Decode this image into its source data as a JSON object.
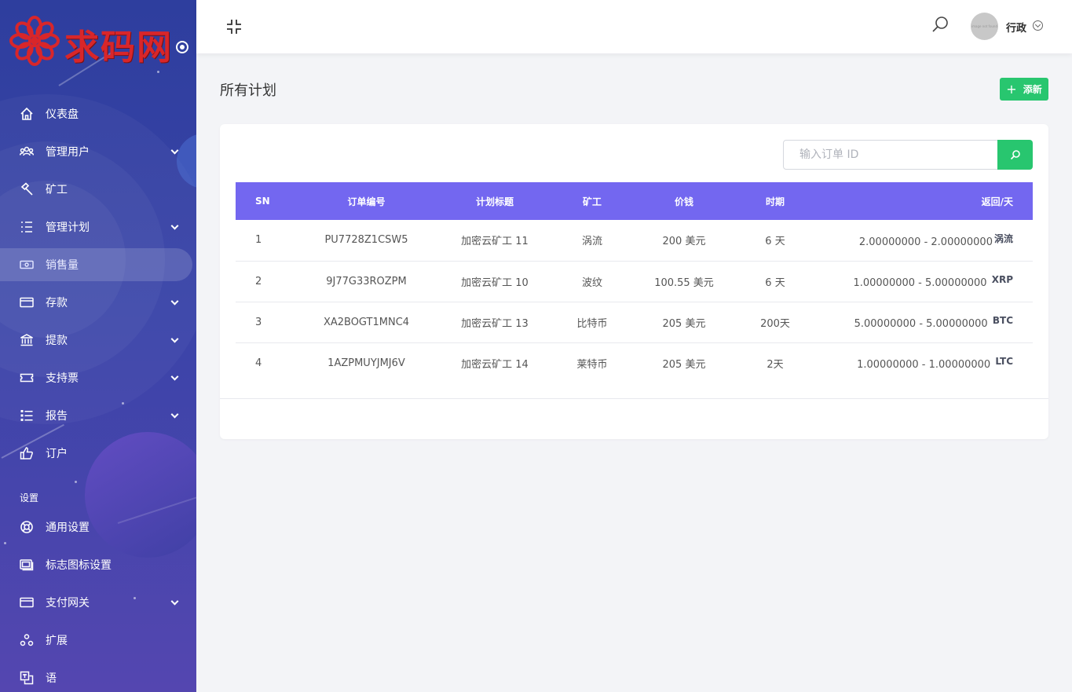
{
  "brand": {
    "logo_text": "求码网"
  },
  "sidebar": {
    "items": [
      {
        "label": "仪表盘",
        "icon": "home-icon",
        "caret": false
      },
      {
        "label": "管理用户",
        "icon": "users-icon",
        "caret": true
      },
      {
        "label": "矿工",
        "icon": "hammer-icon",
        "caret": false
      },
      {
        "label": "管理计划",
        "icon": "list-icon",
        "caret": true
      },
      {
        "label": "销售量",
        "icon": "cash-icon",
        "caret": false,
        "active": true
      },
      {
        "label": "存款",
        "icon": "card-icon",
        "caret": true
      },
      {
        "label": "提款",
        "icon": "bank-icon",
        "caret": true
      },
      {
        "label": "支持票",
        "icon": "ticket-icon",
        "caret": true
      },
      {
        "label": "报告",
        "icon": "report-icon",
        "caret": true
      },
      {
        "label": "订户",
        "icon": "thumb-icon",
        "caret": false
      }
    ],
    "section_label": "设置",
    "settings": [
      {
        "label": "通用设置",
        "icon": "lifebuoy-icon",
        "caret": false
      },
      {
        "label": "标志图标设置",
        "icon": "images-icon",
        "caret": false
      },
      {
        "label": "支付网关",
        "icon": "card-icon",
        "caret": true
      },
      {
        "label": "扩展",
        "icon": "extension-icon",
        "caret": false
      },
      {
        "label": "语",
        "icon": "language-icon",
        "caret": false
      }
    ]
  },
  "header": {
    "user_name": "行政",
    "avatar_text": "image not found"
  },
  "page": {
    "title": "所有计划",
    "add_label": "添新",
    "search_placeholder": "输入订单 ID"
  },
  "table": {
    "columns": [
      "SN",
      "订单编号",
      "计划标题",
      "矿工",
      "价钱",
      "时期",
      "返回/天"
    ],
    "rows": [
      {
        "sn": "1",
        "order": "PU7728Z1CSW5",
        "plan": "加密云矿工 11",
        "miner": "涡流",
        "price": "200 美元",
        "period": "6 天",
        "return": "2.00000000 - 2.00000000",
        "coin": "涡流"
      },
      {
        "sn": "2",
        "order": "9J77G33ROZPM",
        "plan": "加密云矿工 10",
        "miner": "波纹",
        "price": "100.55 美元",
        "period": "6 天",
        "return": "1.00000000 - 5.00000000",
        "coin": "XRP"
      },
      {
        "sn": "3",
        "order": "XA2BOGT1MNC4",
        "plan": "加密云矿工 13",
        "miner": "比特币",
        "price": "205 美元",
        "period": "200天",
        "return": "5.00000000 - 5.00000000",
        "coin": "BTC"
      },
      {
        "sn": "4",
        "order": "1AZPMUYJMJ6V",
        "plan": "加密云矿工 14",
        "miner": "莱特币",
        "price": "205 美元",
        "period": "2天",
        "return": "1.00000000 - 1.00000000",
        "coin": "LTC"
      }
    ]
  },
  "colors": {
    "accent": "#7367f0",
    "success": "#28c66f",
    "sidebar_top": "#2e3e9e",
    "sidebar_bottom": "#5446b0",
    "brand_red": "#d8262a"
  }
}
